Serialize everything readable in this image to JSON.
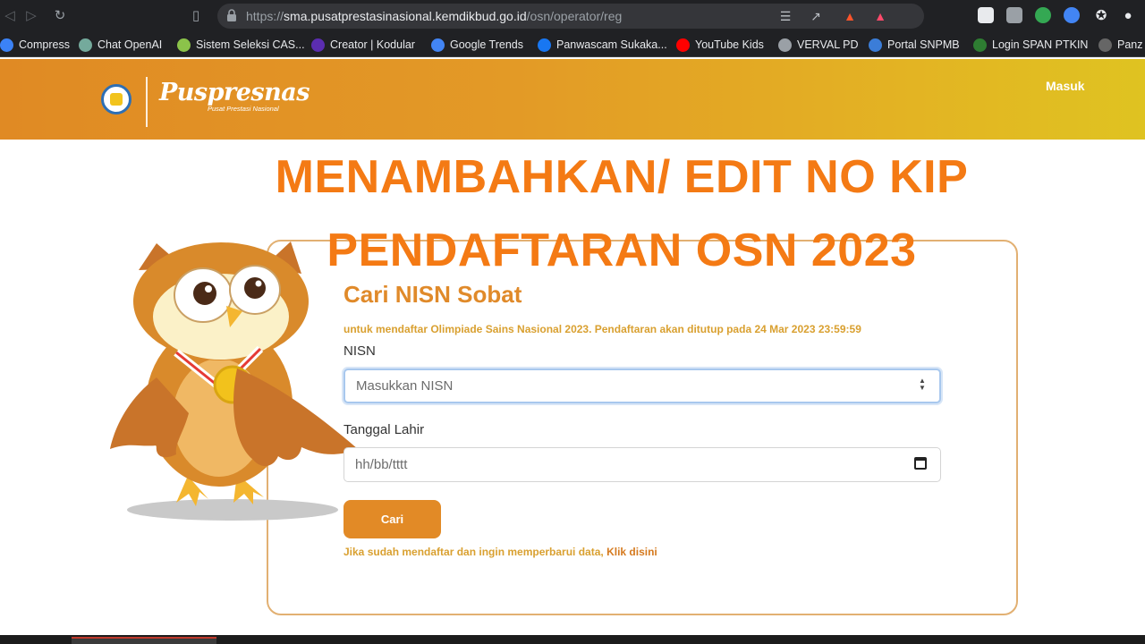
{
  "browser": {
    "url_scheme": "https://",
    "url_host": "sma.pusatprestasinasional.kemdikbud.go.id",
    "url_path": "/osn/operator/reg",
    "bookmarks": [
      {
        "label": "Compress",
        "color": "#3b82f6"
      },
      {
        "label": "Chat OpenAI",
        "color": "#74aa9c"
      },
      {
        "label": "Sistem Seleksi CAS...",
        "color": "#8bc34a"
      },
      {
        "label": "Creator | Kodular",
        "color": "#5b2db0"
      },
      {
        "label": "Google Trends",
        "color": "#4285f4"
      },
      {
        "label": "Panwascam Sukaka...",
        "color": "#1877f2"
      },
      {
        "label": "YouTube Kids",
        "color": "#ff0000"
      },
      {
        "label": "VERVAL PD",
        "color": "#9aa0a6"
      },
      {
        "label": "Portal SNPMB",
        "color": "#3b7dd8"
      },
      {
        "label": "Login SPAN PTKIN",
        "color": "#2e7d32"
      },
      {
        "label": "Panz",
        "color": "#666666"
      }
    ]
  },
  "header": {
    "logo_text": "Puspresnas",
    "logo_subtext": "Pusat Prestasi Nasional",
    "login_label": "Masuk"
  },
  "overlay": {
    "line1": "MENAMBAHKAN/ EDIT NO KIP",
    "line2": "PENDAFTARAN OSN 2023"
  },
  "form": {
    "title": "Cari NISN Sobat",
    "note": "untuk mendaftar Olimpiade Sains Nasional 2023. Pendaftaran akan ditutup pada 24 Mar 2023 23:59:59",
    "nisn_label": "NISN",
    "nisn_placeholder": "Masukkan NISN",
    "dob_label": "Tanggal Lahir",
    "dob_placeholder": "hh/bb/tttt",
    "submit_label": "Cari",
    "update_text": "Jika sudah mendaftar dan ingin memperbarui data, ",
    "update_link": "Klik disini"
  },
  "colors": {
    "accent": "#e28a26",
    "headline": "#f47a14"
  }
}
